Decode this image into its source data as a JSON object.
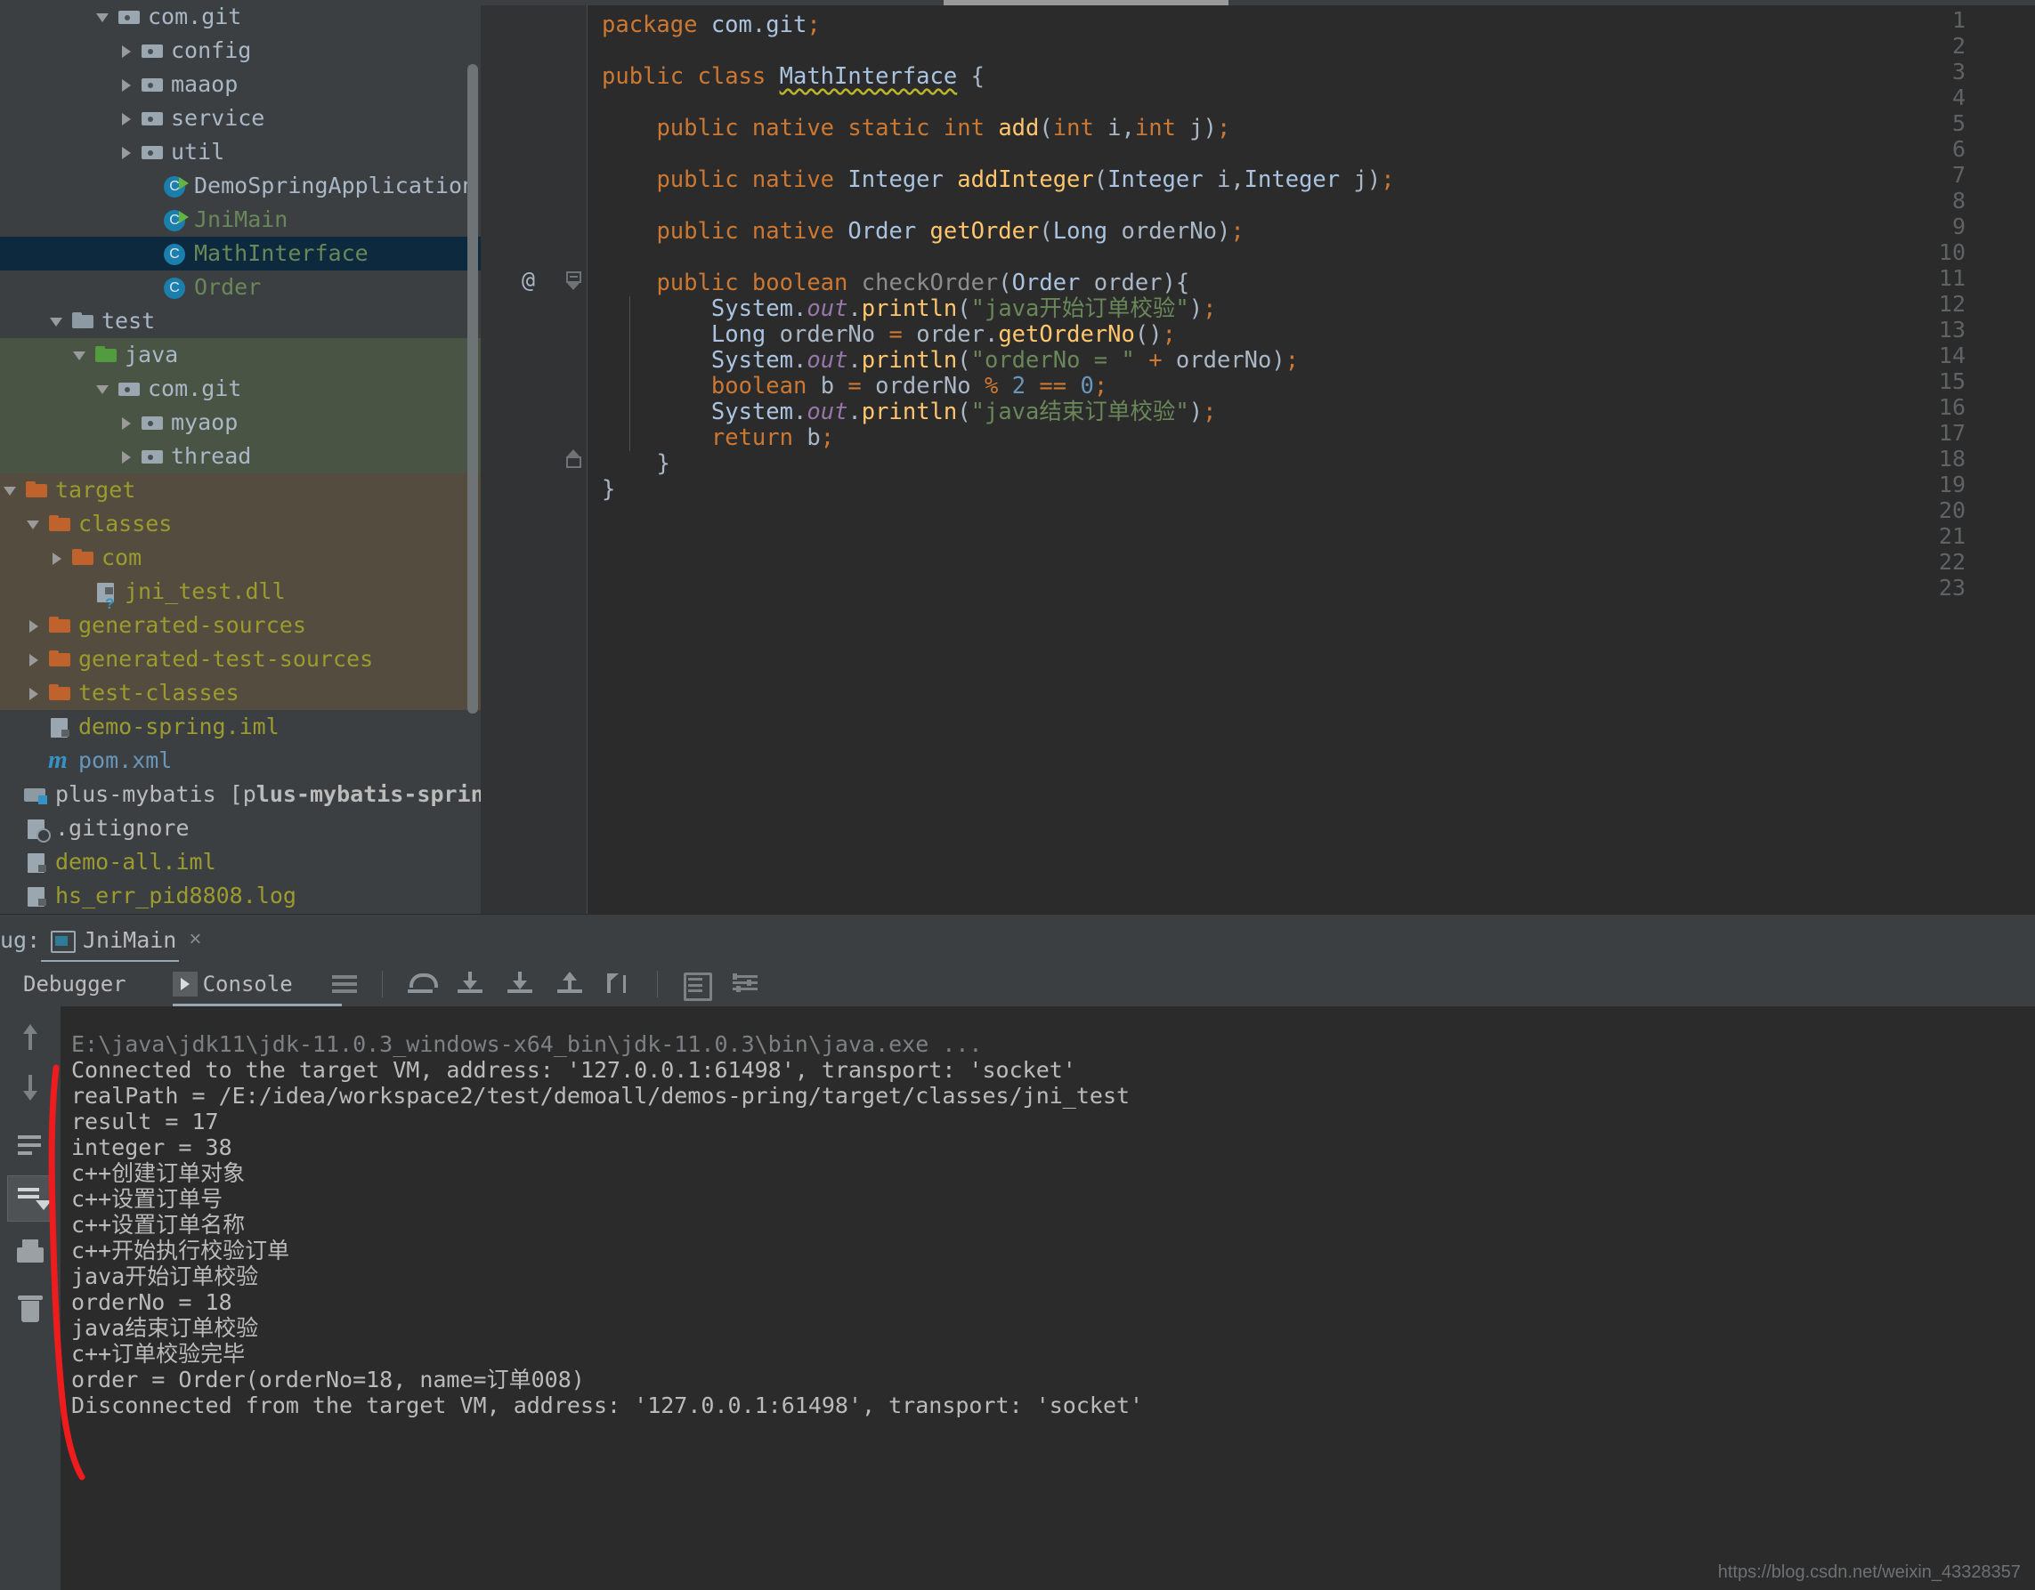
{
  "project_tree": {
    "rows": [
      {
        "indent": 4,
        "arrow": "open",
        "icon": "package-folder-icon",
        "label": "com.git",
        "color": "c-gray",
        "scope": "none"
      },
      {
        "indent": 5,
        "arrow": "closed",
        "icon": "package-folder-icon",
        "label": "config",
        "color": "c-gray",
        "scope": "none"
      },
      {
        "indent": 5,
        "arrow": "closed",
        "icon": "package-folder-icon",
        "label": "maaop",
        "color": "c-gray",
        "scope": "none"
      },
      {
        "indent": 5,
        "arrow": "closed",
        "icon": "package-folder-icon",
        "label": "service",
        "color": "c-gray",
        "scope": "none"
      },
      {
        "indent": 5,
        "arrow": "closed",
        "icon": "package-folder-icon",
        "label": "util",
        "color": "c-gray",
        "scope": "none"
      },
      {
        "indent": 6,
        "arrow": "none",
        "icon": "java-class-runnable-icon",
        "label": "DemoSpringApplication",
        "color": "c-gray",
        "scope": "none"
      },
      {
        "indent": 6,
        "arrow": "none",
        "icon": "java-class-runnable-icon",
        "label": "JniMain",
        "color": "c-green",
        "scope": "none"
      },
      {
        "indent": 6,
        "arrow": "none",
        "icon": "java-class-icon",
        "label": "MathInterface",
        "color": "c-green",
        "scope": "selected"
      },
      {
        "indent": 6,
        "arrow": "none",
        "icon": "java-class-icon",
        "label": "Order",
        "color": "c-green",
        "scope": "none"
      },
      {
        "indent": 2,
        "arrow": "open",
        "icon": "folder-gray-icon",
        "label": "test",
        "color": "c-gray",
        "scope": "none"
      },
      {
        "indent": 3,
        "arrow": "open",
        "icon": "folder-green-icon",
        "label": "java",
        "color": "c-gray",
        "scope": "test"
      },
      {
        "indent": 4,
        "arrow": "open",
        "icon": "package-folder-icon",
        "label": "com.git",
        "color": "c-gray",
        "scope": "test"
      },
      {
        "indent": 5,
        "arrow": "closed",
        "icon": "package-folder-icon",
        "label": "myaop",
        "color": "c-gray",
        "scope": "test"
      },
      {
        "indent": 5,
        "arrow": "closed",
        "icon": "package-folder-icon",
        "label": "thread",
        "color": "c-gray",
        "scope": "test"
      },
      {
        "indent": 0,
        "arrow": "open",
        "icon": "folder-orange-icon",
        "label": "target",
        "color": "c-olive",
        "scope": "target"
      },
      {
        "indent": 1,
        "arrow": "open",
        "icon": "folder-orange-icon",
        "label": "classes",
        "color": "c-olive",
        "scope": "target"
      },
      {
        "indent": 2,
        "arrow": "closed",
        "icon": "folder-orange-icon",
        "label": "com",
        "color": "c-olive",
        "scope": "target"
      },
      {
        "indent": 3,
        "arrow": "none",
        "icon": "unknown-file-icon",
        "label": "jni_test.dll",
        "color": "c-olive",
        "scope": "target"
      },
      {
        "indent": 1,
        "arrow": "closed",
        "icon": "folder-orange-icon",
        "label": "generated-sources",
        "color": "c-olive",
        "scope": "target"
      },
      {
        "indent": 1,
        "arrow": "closed",
        "icon": "folder-orange-icon",
        "label": "generated-test-sources",
        "color": "c-olive",
        "scope": "target"
      },
      {
        "indent": 1,
        "arrow": "closed",
        "icon": "folder-orange-icon",
        "label": "test-classes",
        "color": "c-olive",
        "scope": "target"
      },
      {
        "indent": 1,
        "arrow": "none",
        "icon": "iml-file-icon",
        "label": "demo-spring.iml",
        "color": "c-olive",
        "scope": "none"
      },
      {
        "indent": 1,
        "arrow": "none",
        "icon": "maven-icon",
        "label": "pom.xml",
        "color": "c-blue",
        "scope": "none"
      },
      {
        "indent": 0,
        "arrow": "none",
        "icon": "module-folder-icon",
        "label": "plus-mybatis [plus-mybatis-springbo",
        "color": "c-white",
        "scope": "none",
        "bold_from": 15
      },
      {
        "indent": 0,
        "arrow": "none",
        "icon": "gitignore-file-icon",
        "label": ".gitignore",
        "color": "c-white",
        "scope": "none"
      },
      {
        "indent": 0,
        "arrow": "none",
        "icon": "iml-file-icon",
        "label": "demo-all.iml",
        "color": "c-olive",
        "scope": "none"
      },
      {
        "indent": 0,
        "arrow": "none",
        "icon": "log-file-icon",
        "label": "hs_err_pid8808.log",
        "color": "c-olive",
        "scope": "none"
      }
    ]
  },
  "editor": {
    "line_numbers": [
      "1",
      "2",
      "3",
      "4",
      "5",
      "6",
      "7",
      "8",
      "9",
      "10",
      "11",
      "12",
      "13",
      "14",
      "15",
      "16",
      "17",
      "18",
      "19",
      "20",
      "21",
      "22",
      "23"
    ],
    "annotation_marker": "@",
    "code_lines": [
      "package com.git;",
      "",
      "public class MathInterface {",
      "",
      "    public native static int add(int i,int j);",
      "",
      "    public native Integer addInteger(Integer i,Integer j);",
      "",
      "    public native Order getOrder(Long orderNo);",
      "",
      "    public boolean checkOrder(Order order){",
      "        System.out.println(\"java开始订单校验\");",
      "        Long orderNo = order.getOrderNo();",
      "        System.out.println(\"orderNo = \" + orderNo);",
      "        boolean b = orderNo % 2 == 0;",
      "        System.out.println(\"java结束订单校验\");",
      "        return b;",
      "    }",
      "}",
      "",
      "",
      "",
      ""
    ]
  },
  "debug_panel": {
    "title": "ug:",
    "run_tab_label": "JniMain",
    "run_tab_close": "×",
    "tabs": [
      {
        "label": "Debugger",
        "selected": false
      },
      {
        "label": "Console",
        "selected": true
      }
    ],
    "toolbar_icons": [
      "menu-icon",
      "step-over-icon",
      "step-into-icon",
      "force-step-into-icon",
      "step-out-icon",
      "run-to-cursor-icon",
      "evaluate-expression-icon",
      "settings-lines-icon"
    ],
    "sidebar_icons": [
      "scroll-up-icon",
      "scroll-down-icon",
      "soft-wrap-icon",
      "scroll-to-end-icon",
      "print-icon",
      "clear-all-icon"
    ]
  },
  "console": {
    "lines": [
      {
        "text": "E:\\java\\jdk11\\jdk-11.0.3_windows-x64_bin\\jdk-11.0.3\\bin\\java.exe ...",
        "faded": true
      },
      {
        "text": "Connected to the target VM, address: '127.0.0.1:61498', transport: 'socket'",
        "faded": false
      },
      {
        "text": "realPath = /E:/idea/workspace2/test/demoall/demos-pring/target/classes/jni_test",
        "faded": false
      },
      {
        "text": "result = 17",
        "faded": false
      },
      {
        "text": "integer = 38",
        "faded": false
      },
      {
        "text": "c++创建订单对象",
        "faded": false
      },
      {
        "text": "c++设置订单号",
        "faded": false
      },
      {
        "text": "c++设置订单名称",
        "faded": false
      },
      {
        "text": "c++开始执行校验订单",
        "faded": false
      },
      {
        "text": "java开始订单校验",
        "faded": false
      },
      {
        "text": "orderNo = 18",
        "faded": false
      },
      {
        "text": "java结束订单校验",
        "faded": false
      },
      {
        "text": "c++订单校验完毕",
        "faded": false
      },
      {
        "text": "order = Order(orderNo=18, name=订单008)",
        "faded": false
      },
      {
        "text": "Disconnected from the target VM, address: '127.0.0.1:61498', transport: 'socket'",
        "faded": false
      }
    ]
  },
  "annotation": {
    "color": "#ee1c1c",
    "shape": "hand-drawn-vertical-bracket"
  },
  "watermark": {
    "text": "https://blog.csdn.net/weixin_43328357"
  },
  "colors": {
    "editor_bg": "#2b2b2b",
    "panel_bg": "#3c3f41",
    "gutter_bg": "#313335",
    "selection_bg": "#0d293e",
    "scope_test_bg": "#4a5445",
    "scope_target_bg": "#534c3f",
    "keyword": "#cc7832",
    "string": "#6a8759",
    "number": "#6897bb",
    "static_field": "#9876aa",
    "method": "#ffc66d",
    "type": "#a9c3e0",
    "text": "#a9b7c6"
  }
}
